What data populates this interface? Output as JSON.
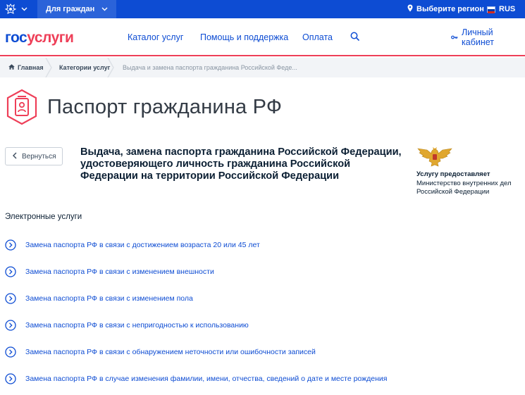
{
  "topbar": {
    "for_citizens": "Для граждан",
    "region": "Выберите регион",
    "lang": "RUS"
  },
  "header": {
    "logo_gos": "гос",
    "logo_uslugi": "услуги",
    "nav": {
      "catalog": "Каталог услуг",
      "help": "Помощь и поддержка",
      "payment": "Оплата",
      "cabinet": "Личный кабинет"
    }
  },
  "breadcrumbs": {
    "home": "Главная",
    "categories": "Категории услуг",
    "current": "Выдача и замена паспорта гражданина Российской Феде..."
  },
  "page": {
    "title": "Паспорт гражданина РФ",
    "back_label": "Вернуться",
    "service_title": "Выдача, замена паспорта гражданина Российской Федерации, удостоверяющего личность гражданина Российской Федерации на территории Российской Федерации"
  },
  "provider": {
    "label": "Услугу предоставляет",
    "name": "Министерство внутренних дел Российской Федерации"
  },
  "eservices": {
    "title": "Электронные услуги",
    "items": [
      "Замена паспорта РФ в связи с достижением возраста 20 или 45 лет",
      "Замена паспорта РФ в связи с изменением внешности",
      "Замена паспорта РФ в связи с изменением пола",
      "Замена паспорта РФ в связи с непригодностью к использованию",
      "Замена паспорта РФ в связи с обнаружением неточности или ошибочности записей",
      "Замена паспорта РФ в случае изменения фамилии, имени, отчества, сведений о дате и месте рождения"
    ]
  },
  "colors": {
    "brand_blue": "#0d4cd3",
    "brand_red": "#ee3f58",
    "breadcrumb_bg": "#f2f4f7"
  },
  "icons": {
    "emblem": "russian-emblem-icon",
    "location": "map-pin-icon",
    "flag": "russian-flag-icon",
    "search": "search-icon",
    "key": "key-icon",
    "home": "home-icon",
    "passport": "passport-icon",
    "back": "chevron-left-icon",
    "service": "chevron-circle-right-icon"
  }
}
